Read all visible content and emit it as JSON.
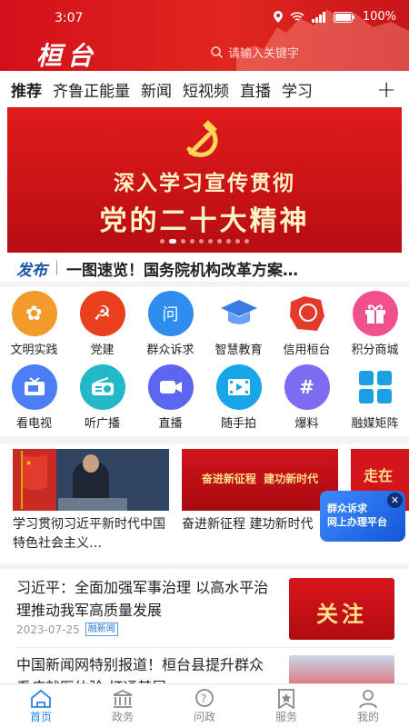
{
  "status": {
    "time": "3:07",
    "battery": "100%"
  },
  "header": {
    "logo": "桓台",
    "search_placeholder": "请输入关键字"
  },
  "tabs": [
    "推荐",
    "齐鲁正能量",
    "新闻",
    "短视频",
    "直播",
    "学习"
  ],
  "banner": {
    "line1": "深入学习宣传贯彻",
    "line2": "党的二十大精神"
  },
  "headline": {
    "label": "发布",
    "text": "一图速览！国务院机构改革方案…"
  },
  "grid": [
    {
      "label": "文明实践",
      "icon": "flower-icon",
      "color": "#f39a2c"
    },
    {
      "label": "党建",
      "icon": "party-emblem-icon",
      "color": "#e8401c"
    },
    {
      "label": "群众诉求",
      "icon": "ask-icon",
      "color": "#2f8df0"
    },
    {
      "label": "智慧教育",
      "icon": "graduation-cap-icon",
      "color": "#3b7be8"
    },
    {
      "label": "信用桓台",
      "icon": "seal-icon",
      "color": "#e43a2c"
    },
    {
      "label": "积分商城",
      "icon": "gift-icon",
      "color": "#f0508c"
    },
    {
      "label": "看电视",
      "icon": "tv-icon",
      "color": "#4c7ef5"
    },
    {
      "label": "听广播",
      "icon": "radio-icon",
      "color": "#22b8c8"
    },
    {
      "label": "直播",
      "icon": "video-camera-icon",
      "color": "#5a66f0"
    },
    {
      "label": "随手拍",
      "icon": "film-icon",
      "color": "#18a6e8"
    },
    {
      "label": "爆料",
      "icon": "hashtag-icon",
      "color": "#7b6cf2"
    },
    {
      "label": "融媒矩阵",
      "icon": "matrix-icon",
      "color": "#1d9fe6"
    }
  ],
  "news_cards": [
    {
      "text": "学习贯彻习近平新时代中国特色社会主义…"
    },
    {
      "text": "奋进新征程 建功新时代",
      "image_text": "奋进新征程  建功新时代"
    },
    {
      "image_text": "走在"
    }
  ],
  "popup": {
    "line1": "群众诉求",
    "line2": "网上办理平台"
  },
  "articles": [
    {
      "title": "习近平：全面加强军事治理 以高水平治理推动我军高质量发展",
      "date": "2023-07-25",
      "tag": "融新闻",
      "thumb_text": "关注"
    },
    {
      "title": "中国新闻网特别报道！桓台县提升群众看病就医体验 打通基层"
    }
  ],
  "tabbar": [
    {
      "label": "首页",
      "icon": "home-icon",
      "active": true
    },
    {
      "label": "政务",
      "icon": "government-building-icon"
    },
    {
      "label": "问政",
      "icon": "question-bubble-icon"
    },
    {
      "label": "服务",
      "icon": "service-star-icon"
    },
    {
      "label": "我的",
      "icon": "user-icon"
    }
  ],
  "colors": {
    "brand_red": "#d3101a",
    "accent_blue": "#2b82e4"
  }
}
